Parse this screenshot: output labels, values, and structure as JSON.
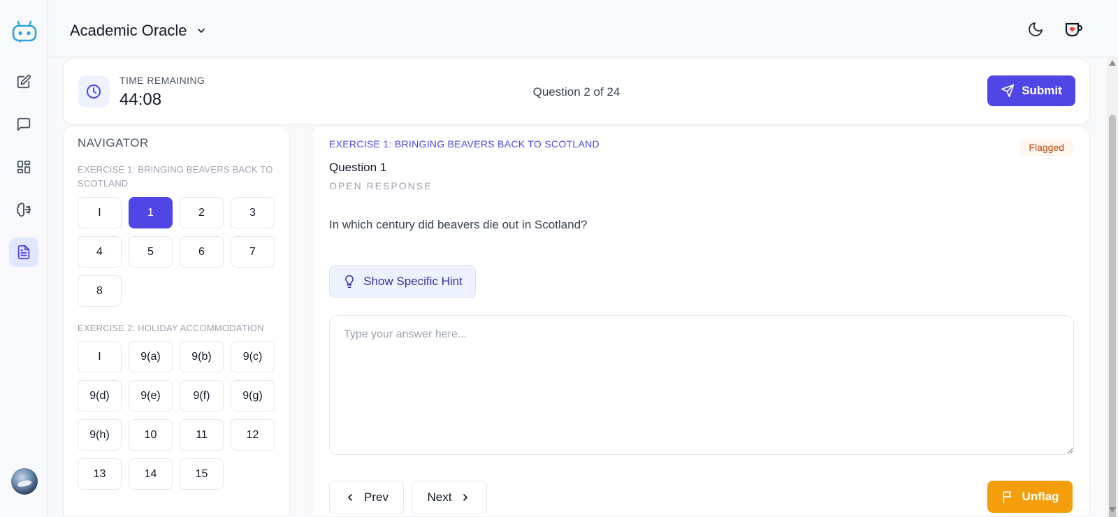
{
  "app": {
    "title": "Academic Oracle"
  },
  "rail": {
    "items": [
      {
        "icon": "edit-icon"
      },
      {
        "icon": "chat-icon"
      },
      {
        "icon": "dashboard-icon"
      },
      {
        "icon": "brain-icon"
      },
      {
        "icon": "document-icon",
        "active": true
      }
    ]
  },
  "timer": {
    "label": "TIME REMAINING",
    "value": "44:08"
  },
  "question_counter": "Question 2 of 24",
  "submit_label": "Submit",
  "navigator": {
    "title": "NAVIGATOR",
    "exercises": [
      {
        "heading": "EXERCISE 1: BRINGING BEAVERS BACK TO SCOTLAND",
        "items": [
          "I",
          "1",
          "2",
          "3",
          "4",
          "5",
          "6",
          "7",
          "8"
        ],
        "current": "1"
      },
      {
        "heading": "EXERCISE 2: HOLIDAY ACCOMMODATION",
        "items": [
          "I",
          "9(a)",
          "9(b)",
          "9(c)",
          "9(d)",
          "9(e)",
          "9(f)",
          "9(g)",
          "9(h)",
          "10",
          "11",
          "12",
          "13",
          "14",
          "15"
        ]
      }
    ]
  },
  "question": {
    "exercise_title": "EXERCISE 1: BRINGING BEAVERS BACK TO SCOTLAND",
    "flag_badge": "Flagged",
    "title": "Question 1",
    "type": "OPEN RESPONSE",
    "text": "In which century did beavers die out in Scotland?",
    "hint_label": "Show Specific Hint",
    "answer_placeholder": "Type your answer here...",
    "answer_value": "",
    "prev_label": "Prev",
    "next_label": "Next",
    "unflag_label": "Unflag"
  },
  "colors": {
    "accent": "#4f46e5",
    "warning": "#f59e0b",
    "flag_text": "#c2410c"
  }
}
